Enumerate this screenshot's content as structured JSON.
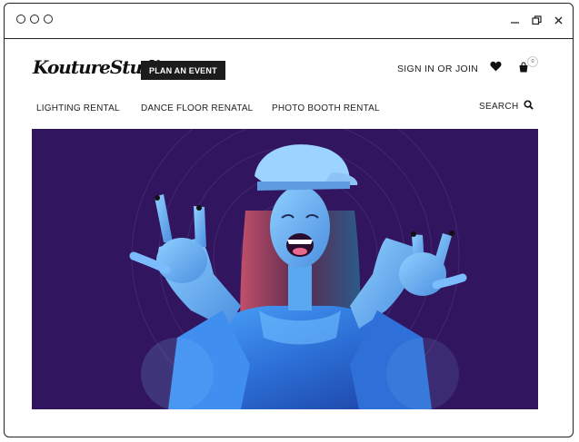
{
  "window": {
    "controls": [
      "minimize",
      "restore",
      "close"
    ]
  },
  "brand": {
    "logo_text": "KoutureStudios"
  },
  "header": {
    "cta_label": "PLAN AN EVENT",
    "signin_label": "SIGN IN OR JOIN",
    "wishlist_icon": "heart-icon",
    "cart_icon": "shopping-bag-icon",
    "cart_count": "0"
  },
  "nav": {
    "items": [
      {
        "label": "LIGHTING RENTAL"
      },
      {
        "label": "DANCE FLOOR RENATAL"
      },
      {
        "label": "PHOTO BOOTH RENTAL"
      }
    ],
    "search_label": "SEARCH",
    "search_icon": "search-icon"
  },
  "hero": {
    "image": "woman-in-cap-rock-hands",
    "background_color": "#31165f",
    "accent_color": "#2f7fe0"
  }
}
